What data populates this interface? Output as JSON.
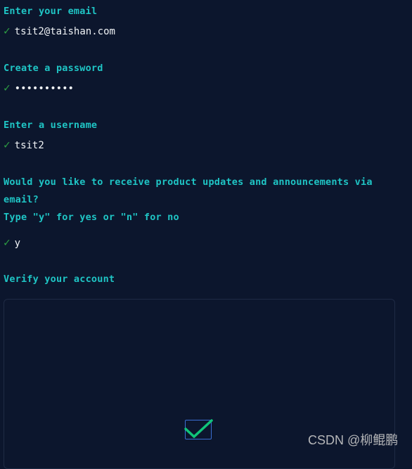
{
  "steps": [
    {
      "prompt": "Enter your email",
      "answer": "tsit2@taishan.com"
    },
    {
      "prompt": "Create a password",
      "answer": "••••••••••"
    },
    {
      "prompt": "Enter a username",
      "answer": "tsit2"
    },
    {
      "prompt": "Would you like to receive product updates and announcements via email?",
      "prompt2": "Type \"y\" for yes or \"n\" for no",
      "answer": "y"
    }
  ],
  "check_glyph": "✓",
  "verify": {
    "prompt": "Verify your account"
  },
  "watermark": "CSDN @柳鲲鹏",
  "colors": {
    "background": "#0c162d",
    "prompt": "#1fc5c5",
    "check": "#2ea043"
  }
}
